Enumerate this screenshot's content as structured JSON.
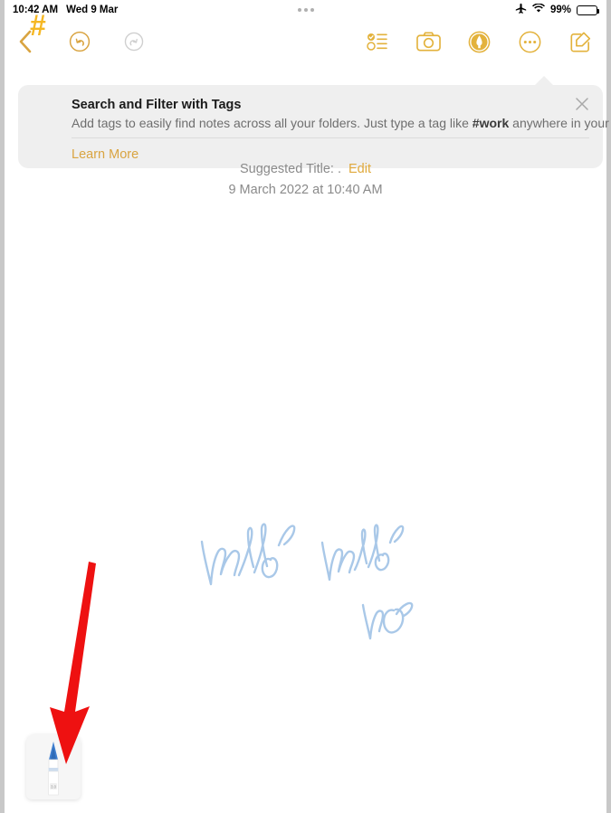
{
  "status_bar": {
    "time": "10:42 AM",
    "date": "Wed 9 Mar",
    "battery_percent": "99%",
    "icons": {
      "multitask_handle": "three-dots-icon",
      "airplane": "airplane-mode-icon",
      "wifi": "wifi-icon",
      "battery": "battery-icon"
    }
  },
  "toolbar": {
    "back_label": "back-chevron",
    "undo_label": "undo",
    "redo_label": "redo",
    "checklist_label": "checklist",
    "camera_label": "camera",
    "markup_label": "markup",
    "more_label": "more",
    "compose_label": "compose"
  },
  "tag_banner": {
    "hash": "#",
    "title": "Search and Filter with Tags",
    "description_part1": "Add tags to easily find notes across all your folders. Just type a tag like ",
    "description_tag": "#work",
    "description_part2": " anywhere in your note.",
    "learn_more": "Learn More",
    "close_icon": "close-icon"
  },
  "note": {
    "suggested_title_label": "Suggested Title: .",
    "edit_label": "Edit",
    "date": "9 March 2022 at 10:40 AM",
    "handwriting": [
      "hello",
      "hello",
      "ho"
    ],
    "ink_color": "#a9c8e8"
  },
  "pen_tool": {
    "name": "pen-tool",
    "tip_color": "#3f7fd0",
    "body_color": "#ffffff"
  },
  "annotation": {
    "arrow_color": "#ee1111"
  },
  "colors": {
    "accent": "#d9a441",
    "banner_bg": "#efefef",
    "hash_gold": "#f5b723"
  }
}
